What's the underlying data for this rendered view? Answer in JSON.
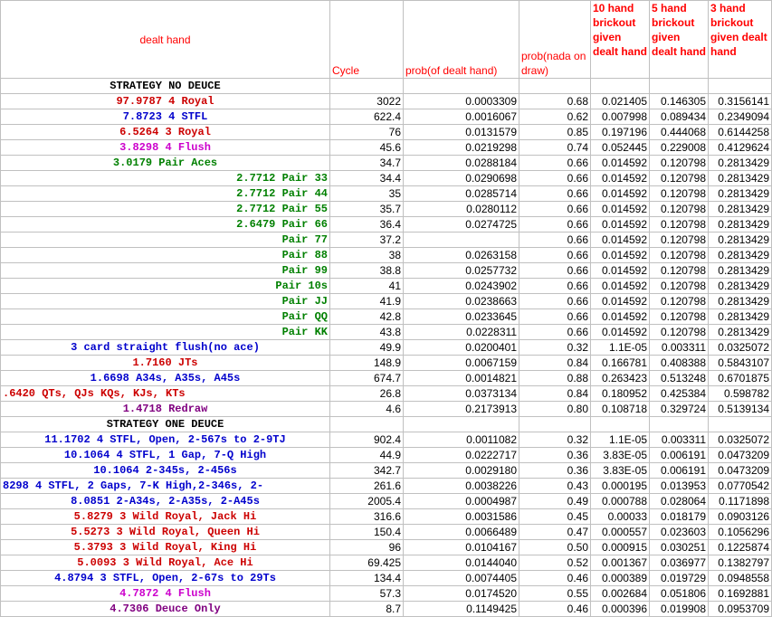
{
  "headers": {
    "dealt_hand": "dealt hand",
    "cycle": "Cycle",
    "prob_dealt": "prob(of dealt hand)",
    "prob_nada": "prob(nada on draw)",
    "brick10": "10 hand brickout given dealt hand",
    "brick5": "5 hand brickout given dealt hand",
    "brick3": "3 hand brickout given dealt hand"
  },
  "colors": {
    "red": "#cc0000",
    "blue": "#0000cc",
    "magenta": "#cc00cc",
    "green": "#008000",
    "purple": "#800080",
    "header_red": "#ff0000",
    "grid": "#c0c0c0"
  },
  "rows": [
    {
      "section": true,
      "label": "STRATEGY NO DEUCE"
    },
    {
      "label": "97.9787 4 Royal",
      "color": "red",
      "align": "center",
      "cycle": "3022",
      "prob": "0.0003309",
      "nada": "0.68",
      "b10": "0.021405",
      "b5": "0.146305",
      "b3": "0.3156141"
    },
    {
      "label": "7.8723 4 STFL",
      "color": "blue",
      "align": "center",
      "cycle": "622.4",
      "prob": "0.0016067",
      "nada": "0.62",
      "b10": "0.007998",
      "b5": "0.089434",
      "b3": "0.2349094"
    },
    {
      "label": "6.5264 3 Royal",
      "color": "red",
      "align": "center",
      "cycle": "76",
      "prob": "0.0131579",
      "nada": "0.85",
      "b10": "0.197196",
      "b5": "0.444068",
      "b3": "0.6144258"
    },
    {
      "label": "3.8298 4 Flush",
      "color": "magenta",
      "align": "center",
      "cycle": "45.6",
      "prob": "0.0219298",
      "nada": "0.74",
      "b10": "0.052445",
      "b5": "0.229008",
      "b3": "0.4129624"
    },
    {
      "label": "3.0179 Pair Aces",
      "color": "green",
      "align": "center",
      "cycle": "34.7",
      "prob": "0.0288184",
      "nada": "0.66",
      "b10": "0.014592",
      "b5": "0.120798",
      "b3": "0.2813429"
    },
    {
      "label": "2.7712 Pair 33",
      "color": "green",
      "align": "right",
      "cycle": "34.4",
      "prob": "0.0290698",
      "nada": "0.66",
      "b10": "0.014592",
      "b5": "0.120798",
      "b3": "0.2813429"
    },
    {
      "label": "2.7712 Pair 44",
      "color": "green",
      "align": "right",
      "cycle": "35",
      "prob": "0.0285714",
      "nada": "0.66",
      "b10": "0.014592",
      "b5": "0.120798",
      "b3": "0.2813429"
    },
    {
      "label": "2.7712 Pair 55",
      "color": "green",
      "align": "right",
      "cycle": "35.7",
      "prob": "0.0280112",
      "nada": "0.66",
      "b10": "0.014592",
      "b5": "0.120798",
      "b3": "0.2813429"
    },
    {
      "label": "2.6479 Pair 66",
      "color": "green",
      "align": "right",
      "cycle": "36.4",
      "prob": "0.0274725",
      "nada": "0.66",
      "b10": "0.014592",
      "b5": "0.120798",
      "b3": "0.2813429"
    },
    {
      "label": "Pair 77",
      "color": "green",
      "align": "right",
      "cycle": "37.2",
      "prob": "",
      "nada": "0.66",
      "b10": "0.014592",
      "b5": "0.120798",
      "b3": "0.2813429"
    },
    {
      "label": "Pair 88",
      "color": "green",
      "align": "right",
      "cycle": "38",
      "prob": "0.0263158",
      "nada": "0.66",
      "b10": "0.014592",
      "b5": "0.120798",
      "b3": "0.2813429"
    },
    {
      "label": "Pair 99",
      "color": "green",
      "align": "right",
      "cycle": "38.8",
      "prob": "0.0257732",
      "nada": "0.66",
      "b10": "0.014592",
      "b5": "0.120798",
      "b3": "0.2813429"
    },
    {
      "label": "Pair 10s",
      "color": "green",
      "align": "right",
      "cycle": "41",
      "prob": "0.0243902",
      "nada": "0.66",
      "b10": "0.014592",
      "b5": "0.120798",
      "b3": "0.2813429"
    },
    {
      "label": "Pair JJ",
      "color": "green",
      "align": "right",
      "cycle": "41.9",
      "prob": "0.0238663",
      "nada": "0.66",
      "b10": "0.014592",
      "b5": "0.120798",
      "b3": "0.2813429"
    },
    {
      "label": "Pair QQ",
      "color": "green",
      "align": "right",
      "cycle": "42.8",
      "prob": "0.0233645",
      "nada": "0.66",
      "b10": "0.014592",
      "b5": "0.120798",
      "b3": "0.2813429"
    },
    {
      "label": "Pair KK",
      "color": "green",
      "align": "right",
      "cycle": "43.8",
      "prob": "0.0228311",
      "nada": "0.66",
      "b10": "0.014592",
      "b5": "0.120798",
      "b3": "0.2813429"
    },
    {
      "label": "3 card straight flush(no ace)",
      "color": "blue",
      "align": "center",
      "cycle": "49.9",
      "prob": "0.0200401",
      "nada": "0.32",
      "b10": "1.1E-05",
      "b5": "0.003311",
      "b3": "0.0325072"
    },
    {
      "label": "1.7160 JTs",
      "color": "red",
      "align": "center",
      "cycle": "148.9",
      "prob": "0.0067159",
      "nada": "0.84",
      "b10": "0.166781",
      "b5": "0.408388",
      "b3": "0.5843107"
    },
    {
      "label": "1.6698 A34s, A35s, A45s",
      "color": "blue",
      "align": "center",
      "cycle": "674.7",
      "prob": "0.0014821",
      "nada": "0.88",
      "b10": "0.263423",
      "b5": "0.513248",
      "b3": "0.6701875"
    },
    {
      "label": ".6420 QTs, QJs KQs, KJs, KTs",
      "color": "red",
      "align": "left",
      "cycle": "26.8",
      "prob": "0.0373134",
      "nada": "0.84",
      "b10": "0.180952",
      "b5": "0.425384",
      "b3": "0.598782"
    },
    {
      "label": "1.4718 Redraw",
      "color": "purple",
      "align": "center",
      "cycle": "4.6",
      "prob": "0.2173913",
      "nada": "0.80",
      "b10": "0.108718",
      "b5": "0.329724",
      "b3": "0.5139134"
    },
    {
      "section": true,
      "label": "STRATEGY ONE DEUCE"
    },
    {
      "label": "11.1702 4 STFL, Open, 2-567s to 2-9TJ",
      "color": "blue",
      "align": "center",
      "cycle": "902.4",
      "prob": "0.0011082",
      "nada": "0.32",
      "b10": "1.1E-05",
      "b5": "0.003311",
      "b3": "0.0325072"
    },
    {
      "label": "10.1064 4 STFL, 1 Gap, 7-Q High",
      "color": "blue",
      "align": "center",
      "cycle": "44.9",
      "prob": "0.0222717",
      "nada": "0.36",
      "b10": "3.83E-05",
      "b5": "0.006191",
      "b3": "0.0473209"
    },
    {
      "label": "10.1064 2-345s, 2-456s",
      "color": "blue",
      "align": "center",
      "cycle": "342.7",
      "prob": "0.0029180",
      "nada": "0.36",
      "b10": "3.83E-05",
      "b5": "0.006191",
      "b3": "0.0473209"
    },
    {
      "label": "8298 4 STFL, 2 Gaps, 7-K High,2-346s, 2-",
      "color": "blue",
      "align": "left",
      "cycle": "261.6",
      "prob": "0.0038226",
      "nada": "0.43",
      "b10": "0.000195",
      "b5": "0.013953",
      "b3": "0.0770542"
    },
    {
      "label": "8.0851 2-A34s, 2-A35s, 2-A45s",
      "color": "blue",
      "align": "center",
      "cycle": "2005.4",
      "prob": "0.0004987",
      "nada": "0.49",
      "b10": "0.000788",
      "b5": "0.028064",
      "b3": "0.1171898"
    },
    {
      "label": "5.8279 3 Wild Royal, Jack Hi",
      "color": "red",
      "align": "center",
      "cycle": "316.6",
      "prob": "0.0031586",
      "nada": "0.45",
      "b10": "0.00033",
      "b5": "0.018179",
      "b3": "0.0903126"
    },
    {
      "label": "5.5273 3 Wild Royal, Queen Hi",
      "color": "red",
      "align": "center",
      "cycle": "150.4",
      "prob": "0.0066489",
      "nada": "0.47",
      "b10": "0.000557",
      "b5": "0.023603",
      "b3": "0.1056296"
    },
    {
      "label": "5.3793 3 Wild Royal, King Hi",
      "color": "red",
      "align": "center",
      "cycle": "96",
      "prob": "0.0104167",
      "nada": "0.50",
      "b10": "0.000915",
      "b5": "0.030251",
      "b3": "0.1225874"
    },
    {
      "label": "5.0093 3 Wild Royal, Ace Hi",
      "color": "red",
      "align": "center",
      "cycle": "69.425",
      "prob": "0.0144040",
      "nada": "0.52",
      "b10": "0.001367",
      "b5": "0.036977",
      "b3": "0.1382797"
    },
    {
      "label": "4.8794 3 STFL, Open, 2-67s to 29Ts",
      "color": "blue",
      "align": "center",
      "cycle": "134.4",
      "prob": "0.0074405",
      "nada": "0.46",
      "b10": "0.000389",
      "b5": "0.019729",
      "b3": "0.0948558"
    },
    {
      "label": "4.7872 4 Flush",
      "color": "magenta",
      "align": "center",
      "cycle": "57.3",
      "prob": "0.0174520",
      "nada": "0.55",
      "b10": "0.002684",
      "b5": "0.051806",
      "b3": "0.1692881"
    },
    {
      "label": "4.7306 Deuce Only",
      "color": "purple",
      "align": "center",
      "cycle": "8.7",
      "prob": "0.1149425",
      "nada": "0.46",
      "b10": "0.000396",
      "b5": "0.019908",
      "b3": "0.0953709"
    }
  ]
}
